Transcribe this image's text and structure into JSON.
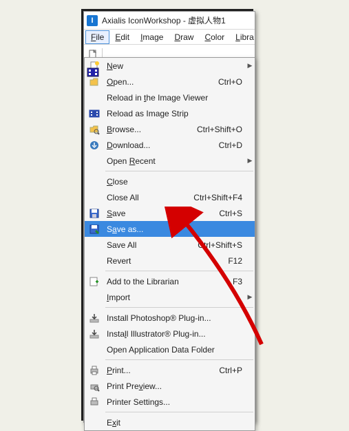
{
  "window": {
    "app_icon_letter": "I",
    "title": "Axialis IconWorkshop - 虚拟人物1"
  },
  "menubar": [
    "File",
    "Edit",
    "Image",
    "Draw",
    "Color",
    "Libra"
  ],
  "menubar_u": [
    "F",
    "E",
    "I",
    "D",
    "C",
    "L"
  ],
  "file_menu": [
    {
      "icon": "new-icon",
      "label": "New",
      "u": "N",
      "shortcut": "",
      "sub": true
    },
    {
      "icon": "open-icon",
      "label": "Open...",
      "u": "O",
      "shortcut": "Ctrl+O",
      "sub": false
    },
    {
      "icon": "",
      "label": "Reload in the Image Viewer",
      "u": "t",
      "shortcut": "",
      "sub": false
    },
    {
      "icon": "strip-icon",
      "label": "Reload as Image Strip",
      "u": "",
      "shortcut": "",
      "sub": false
    },
    {
      "icon": "browse-icon",
      "label": "Browse...",
      "u": "B",
      "shortcut": "Ctrl+Shift+O",
      "sub": false
    },
    {
      "icon": "download-icon",
      "label": "Download...",
      "u": "D",
      "shortcut": "Ctrl+D",
      "sub": false
    },
    {
      "icon": "",
      "label": "Open Recent",
      "u": "R",
      "shortcut": "",
      "sub": true
    },
    {
      "sep": true
    },
    {
      "icon": "",
      "label": "Close",
      "u": "C",
      "shortcut": "",
      "sub": false
    },
    {
      "icon": "",
      "label": "Close All",
      "u": "",
      "shortcut": "Ctrl+Shift+F4",
      "sub": false
    },
    {
      "icon": "save-icon",
      "label": "Save",
      "u": "S",
      "shortcut": "Ctrl+S",
      "sub": false
    },
    {
      "icon": "saveas-icon",
      "label": "Save as...",
      "u": "a",
      "shortcut": "",
      "sub": false,
      "highlight": true
    },
    {
      "icon": "",
      "label": "Save All",
      "u": "",
      "shortcut": "Ctrl+Shift+S",
      "sub": false
    },
    {
      "icon": "",
      "label": "Revert",
      "u": "",
      "shortcut": "F12",
      "sub": false
    },
    {
      "sep": true
    },
    {
      "icon": "library-icon",
      "label": "Add to the Librarian",
      "u": "",
      "shortcut": "F3",
      "sub": false
    },
    {
      "icon": "",
      "label": "Import",
      "u": "I",
      "shortcut": "",
      "sub": true
    },
    {
      "sep": true
    },
    {
      "icon": "install-icon",
      "label": "Install Photoshop® Plug-in...",
      "u": "",
      "shortcut": "",
      "sub": false
    },
    {
      "icon": "install-icon",
      "label": "Install Illustrator® Plug-in...",
      "u": "l",
      "shortcut": "",
      "sub": false
    },
    {
      "icon": "",
      "label": "Open Application Data Folder",
      "u": "",
      "shortcut": "",
      "sub": false
    },
    {
      "sep": true
    },
    {
      "icon": "print-icon",
      "label": "Print...",
      "u": "P",
      "shortcut": "Ctrl+P",
      "sub": false
    },
    {
      "icon": "preview-icon",
      "label": "Print Preview...",
      "u": "v",
      "shortcut": "",
      "sub": false
    },
    {
      "icon": "printer-icon",
      "label": "Printer Settings...",
      "u": "",
      "shortcut": "",
      "sub": false
    },
    {
      "sep": true
    },
    {
      "icon": "",
      "label": "Exit",
      "u": "x",
      "shortcut": "",
      "sub": false
    }
  ]
}
